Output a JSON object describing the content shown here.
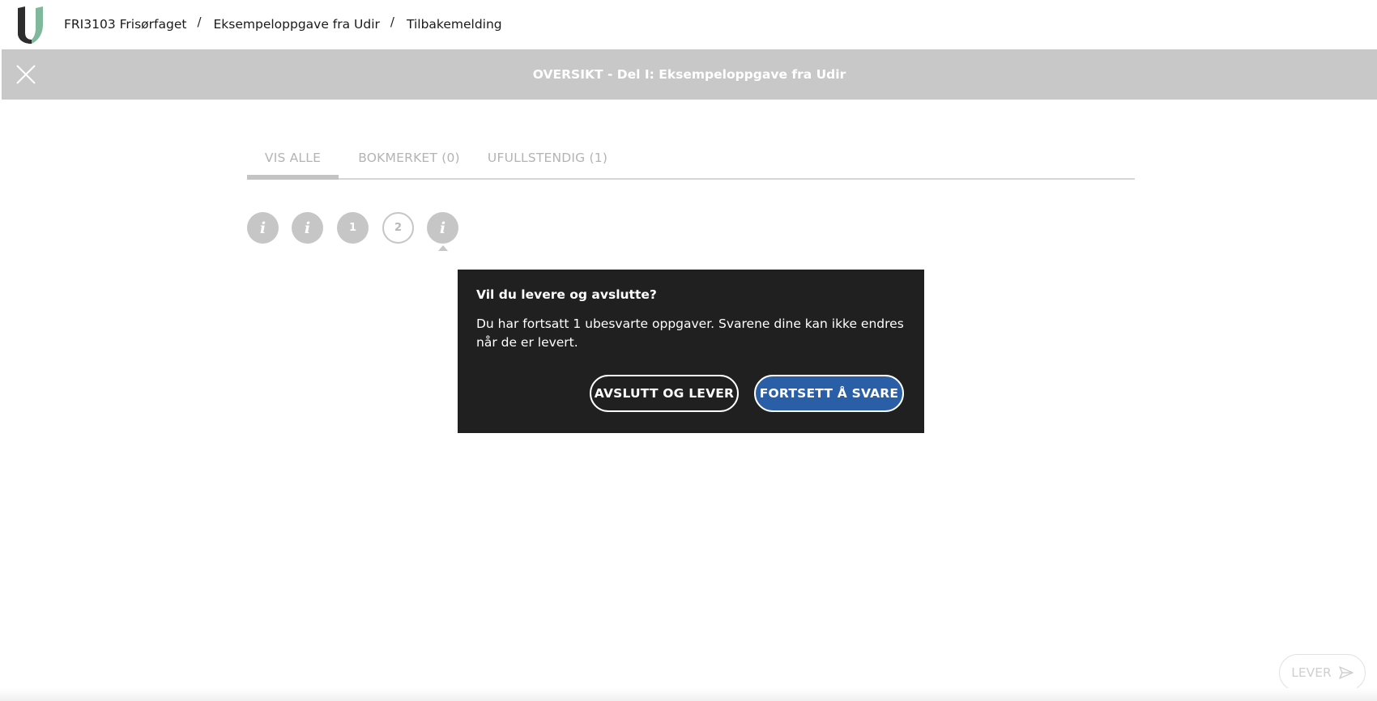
{
  "breadcrumb": {
    "items": [
      "FRI3103 Frisørfaget",
      "Eksempeloppgave fra Udir",
      "Tilbakemelding"
    ],
    "separator": "/"
  },
  "header": {
    "title": "OVERSIKT - Del I: Eksempeloppgave fra Udir",
    "close_icon": "close-icon"
  },
  "tabs": [
    {
      "label": "VIS ALLE",
      "active": true
    },
    {
      "label": "BOKMERKET (0)",
      "active": false
    },
    {
      "label": "UFULLSTENDIG (1)",
      "active": false
    }
  ],
  "questions": [
    {
      "label": "i",
      "kind": "info"
    },
    {
      "label": "i",
      "kind": "info"
    },
    {
      "label": "1",
      "kind": "answered"
    },
    {
      "label": "2",
      "kind": "unanswered"
    },
    {
      "label": "i",
      "kind": "info",
      "current": true
    }
  ],
  "dialog": {
    "title": "Vil du levere og avslutte?",
    "text": "Du har fortsatt 1 ubesvarte oppgaver. Svarene dine kan ikke endres når de er levert.",
    "secondary_button": "AVSLUTT OG LEVER",
    "primary_button": "FORTSETT Å SVARE"
  },
  "lever_button": {
    "label": "LEVER",
    "icon": "send-icon"
  },
  "colors": {
    "header_bg": "#c8c8c8",
    "dialog_bg": "#202020",
    "primary": "#2a5fa8",
    "logo_dark": "#2d2d2d",
    "logo_green": "#7fb89a"
  }
}
